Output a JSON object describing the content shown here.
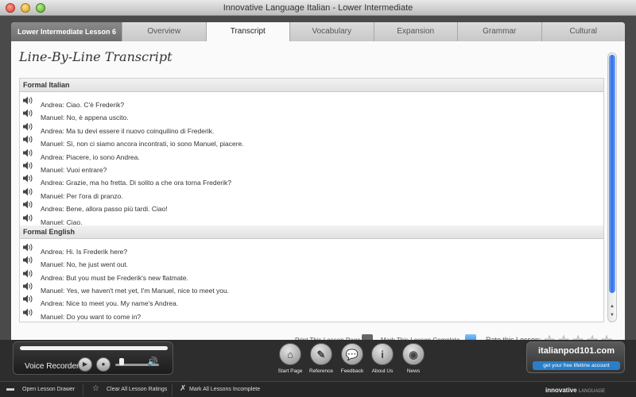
{
  "window": {
    "title": "Innovative Language Italian - Lower Intermediate"
  },
  "tabs": {
    "lesson": "Lower Intermediate Lesson 6",
    "items": [
      "Overview",
      "Transcript",
      "Vocabulary",
      "Expansion",
      "Grammar",
      "Cultural"
    ],
    "active": "Transcript"
  },
  "page": {
    "title": "Line-By-Line Transcript"
  },
  "transcript": {
    "italian_header": "Formal Italian",
    "italian": [
      "Andrea: Ciao. C'è Frederik?",
      "Manuel: No, è appena uscito.",
      "Andrea: Ma tu devi essere il nuovo coinquilino di Frederik.",
      "Manuel: Sì, non ci siamo ancora incontrati, io sono Manuel, piacere.",
      "Andrea: Piacere, io sono Andrea.",
      "Manuel: Vuoi entrare?",
      "Andrea: Grazie, ma ho fretta. Di solito a che ora torna Frederik?",
      "Manuel: Per l'ora di pranzo.",
      "Andrea: Bene, allora passo più tardi. Ciao!",
      "Manuel: Ciao."
    ],
    "english_header": "Formal English",
    "english": [
      "Andrea: Hi. Is Frederik here?",
      "Manuel: No, he just went out.",
      "Andrea: But you must be Frederik's new flatmate.",
      "Manuel: Yes, we haven't met yet, I'm Manuel, nice to meet you.",
      "Andrea: Nice to meet you. My name's Andrea.",
      "Manuel: Do you want to come in?"
    ]
  },
  "actions": {
    "print": "Print This Lesson Page",
    "complete": "Mark This Lesson Complete",
    "rate": "Rate this Lesson:",
    "rating_stars": 0
  },
  "recorder": {
    "label": "Voice Recorder",
    "play_glyph": "▶",
    "stop_glyph": "●",
    "volume_glyph": "🔊"
  },
  "nav": [
    {
      "label": "Start Page",
      "icon": "home-icon",
      "glyph": "⌂"
    },
    {
      "label": "Reference",
      "icon": "pen-icon",
      "glyph": "✎"
    },
    {
      "label": "Feedback",
      "icon": "speech-bubble-icon",
      "glyph": "💬"
    },
    {
      "label": "About Us",
      "icon": "info-icon",
      "glyph": "i"
    },
    {
      "label": "News",
      "icon": "rss-icon",
      "glyph": "◉"
    }
  ],
  "brand": {
    "name": "italianpod101.com",
    "cta": "get your free lifetime account"
  },
  "statusbar": {
    "open_drawer": "Open Lesson Drawer",
    "clear_ratings": "Clear All Lesson Ratings",
    "mark_incomplete": "Mark All Lessons Incomplete",
    "brand": "innovative",
    "brand_suffix": "LANGUAGE"
  }
}
